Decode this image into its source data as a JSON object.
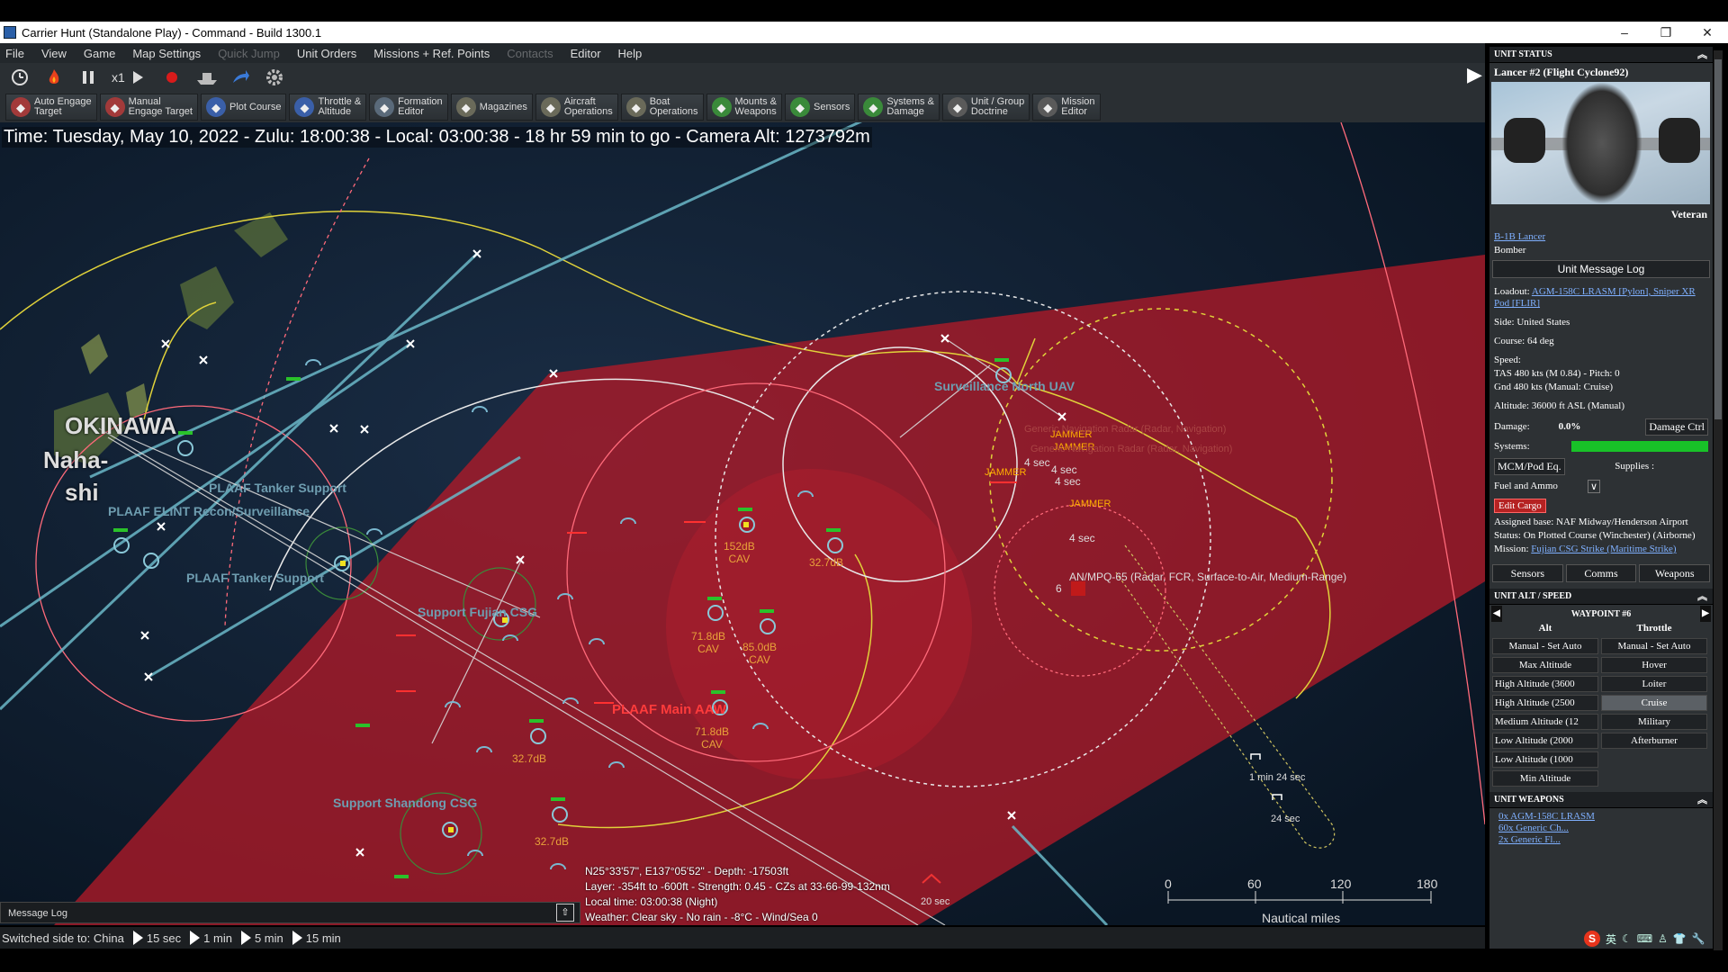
{
  "window": {
    "title": "Carrier Hunt (Standalone Play) - Command - Build 1300.1",
    "controls": [
      "–",
      "❐",
      "✕"
    ]
  },
  "menu": [
    {
      "label": "File",
      "enabled": true
    },
    {
      "label": "View",
      "enabled": true
    },
    {
      "label": "Game",
      "enabled": true
    },
    {
      "label": "Map Settings",
      "enabled": true
    },
    {
      "label": "Quick Jump",
      "enabled": false
    },
    {
      "label": "Unit Orders",
      "enabled": true
    },
    {
      "label": "Missions + Ref. Points",
      "enabled": true
    },
    {
      "label": "Contacts",
      "enabled": false
    },
    {
      "label": "Editor",
      "enabled": true
    },
    {
      "label": "Help",
      "enabled": true
    }
  ],
  "controls": {
    "speed": "x1"
  },
  "toolbar": [
    {
      "label": "Auto Engage\nTarget",
      "icon": "crosshair-icon",
      "color": "#a23a3a"
    },
    {
      "label": "Manual\nEngage Target",
      "icon": "crosshair-icon",
      "color": "#a23a3a"
    },
    {
      "label": "Plot Course",
      "icon": "compass-icon",
      "color": "#3a5fa8"
    },
    {
      "label": "Throttle &\nAltitude",
      "icon": "gauge-icon",
      "color": "#3a5fa8"
    },
    {
      "label": "Formation\nEditor",
      "icon": "formation-icon",
      "color": "#5a6a7a"
    },
    {
      "label": "Magazines",
      "icon": "ammo-icon",
      "color": "#6a6a5a"
    },
    {
      "label": "Aircraft\nOperations",
      "icon": "aircraft-icon",
      "color": "#6a6a5a"
    },
    {
      "label": "Boat\nOperations",
      "icon": "boat-icon",
      "color": "#6a6a5a"
    },
    {
      "label": "Mounts &\nWeapons",
      "icon": "missile-icon",
      "color": "#3a8a3a"
    },
    {
      "label": "Sensors",
      "icon": "radar-icon",
      "color": "#3a8a3a"
    },
    {
      "label": "Systems &\nDamage",
      "icon": "gear-icon",
      "color": "#3a8a3a"
    },
    {
      "label": "Unit / Group\nDoctrine",
      "icon": "doctrine-icon",
      "color": "#5a5a5a"
    },
    {
      "label": "Mission\nEditor",
      "icon": "mission-icon",
      "color": "#5a5a5a"
    }
  ],
  "map": {
    "time_readout": "Time: Tuesday, May 10, 2022 - Zulu: 18:00:38 - Local: 03:00:38 - 18 hr 59 min to go -  Camera Alt: 1273792m",
    "city": [
      "OKINAWA",
      "Naha-",
      "shi"
    ],
    "groups": [
      {
        "name": "PLAAF Tanker Support"
      },
      {
        "name": "PLAAF ELINT Recon/Surveillance"
      },
      {
        "name": "PLAAF Tanker Support"
      },
      {
        "name": "Support Fujian CSG"
      },
      {
        "name": "Support Shandong CSG"
      },
      {
        "name": "Surveillance North UAV"
      }
    ],
    "main_group": "PLAAF Main AAW",
    "signals": [
      {
        "text": "152dB\nCAV"
      },
      {
        "text": "32.7dB"
      },
      {
        "text": "71.8dB\nCAV"
      },
      {
        "text": "85.0dB\nCAV"
      },
      {
        "text": "71.8dB\nCAV"
      },
      {
        "text": "32.7dB"
      },
      {
        "text": "32.7dB"
      }
    ],
    "jammers": [
      "JAMMER",
      "JAMMER",
      "JAMMER",
      "JAMMER"
    ],
    "timers": [
      "4 sec",
      "4 sec",
      "4 sec",
      "4 sec"
    ],
    "radar_faint": [
      "Generic Navigation Radar (Radar, Navigation)",
      "Generic Navigation Radar (Radar, Navigation)"
    ],
    "sam_label": "AN/MPQ-65 (Radar, FCR, Surface-to-Air, Medium-Range)",
    "sam_count": "6",
    "flight_times": [
      "1 min 24 sec",
      "24 sec",
      "20 sec"
    ],
    "cursor_info": [
      "N25°33'57\", E137°05'52\" - Depth: -17503ft",
      "Layer: -354ft to -600ft - Strength: 0.45 - CZs at 33-66-99-132nm",
      "Local time: 03:00:38 (Night)",
      "Weather: Clear sky - No rain - -8°C - Wind/Sea 0"
    ],
    "scale": {
      "ticks": [
        "0",
        "60",
        "120",
        "180"
      ],
      "unit": "Nautical miles"
    }
  },
  "message_log": {
    "label": "Message Log",
    "toggle": "⇧"
  },
  "statusbar": {
    "side": "Switched side to: China",
    "compression": [
      "15 sec",
      "1 min",
      "5 min",
      "15 min"
    ]
  },
  "panel": {
    "unit_status_title": "UNIT STATUS",
    "unit_name": "Lancer #2 (Flight Cyclone92)",
    "rank": "Veteran",
    "class_link": "B-1B Lancer",
    "type": "Bomber",
    "message_log_btn": "Unit Message Log",
    "loadout_label": "Loadout:",
    "loadout": "AGM-158C LRASM [Pylon], Sniper XR Pod [FLIR]",
    "side": "Side: United States",
    "course": "Course: 64 deg",
    "speed_label": "Speed:",
    "speed_tas": "TAS 480 kts (M 0.84) - Pitch: 0",
    "speed_gnd": "Gnd 480 kts (Manual: Cruise)",
    "altitude": "Altitude: 36000 ft ASL (Manual)",
    "damage_label": "Damage:",
    "damage_value": "0.0%",
    "damage_btn": "Damage Ctrl",
    "systems_label": "Systems:",
    "systems_level": 1.0,
    "mcm_btn": "MCM/Pod Eq.",
    "supplies_label": "Supplies :",
    "supplies_value": "Fuel and Ammo",
    "edit_cargo": "Edit Cargo",
    "assigned_base": "Assigned base: NAF Midway/Henderson Airport",
    "status": "Status: On Plotted Course (Winchester) (Airborne)",
    "mission_label": "Mission:",
    "mission": "Fujian CSG Strike (Maritime Strike)",
    "tabs": [
      "Sensors",
      "Comms",
      "Weapons"
    ],
    "alt_speed_title": "UNIT ALT / SPEED",
    "waypoint": "WAYPOINT #6",
    "alt_header": "Alt",
    "throttle_header": "Throttle",
    "alt_modes": [
      "Manual - Set Auto",
      "Max Altitude",
      "High Altitude (3600",
      "High Altitude (2500",
      "Medium Altitude (12",
      "Low Altitude (2000",
      "Low Altitude (1000",
      "Min Altitude"
    ],
    "throttle_modes": [
      "Manual - Set Auto",
      "Hover",
      "Loiter",
      "Cruise",
      "Military",
      "Afterburner"
    ],
    "throttle_selected": "Cruise",
    "weapons_title": "UNIT WEAPONS",
    "weapons": [
      "0x AGM-158C LRASM",
      "60x Generic Ch...",
      "2x Generic Fl..."
    ]
  },
  "tray": {
    "ime": "英"
  }
}
